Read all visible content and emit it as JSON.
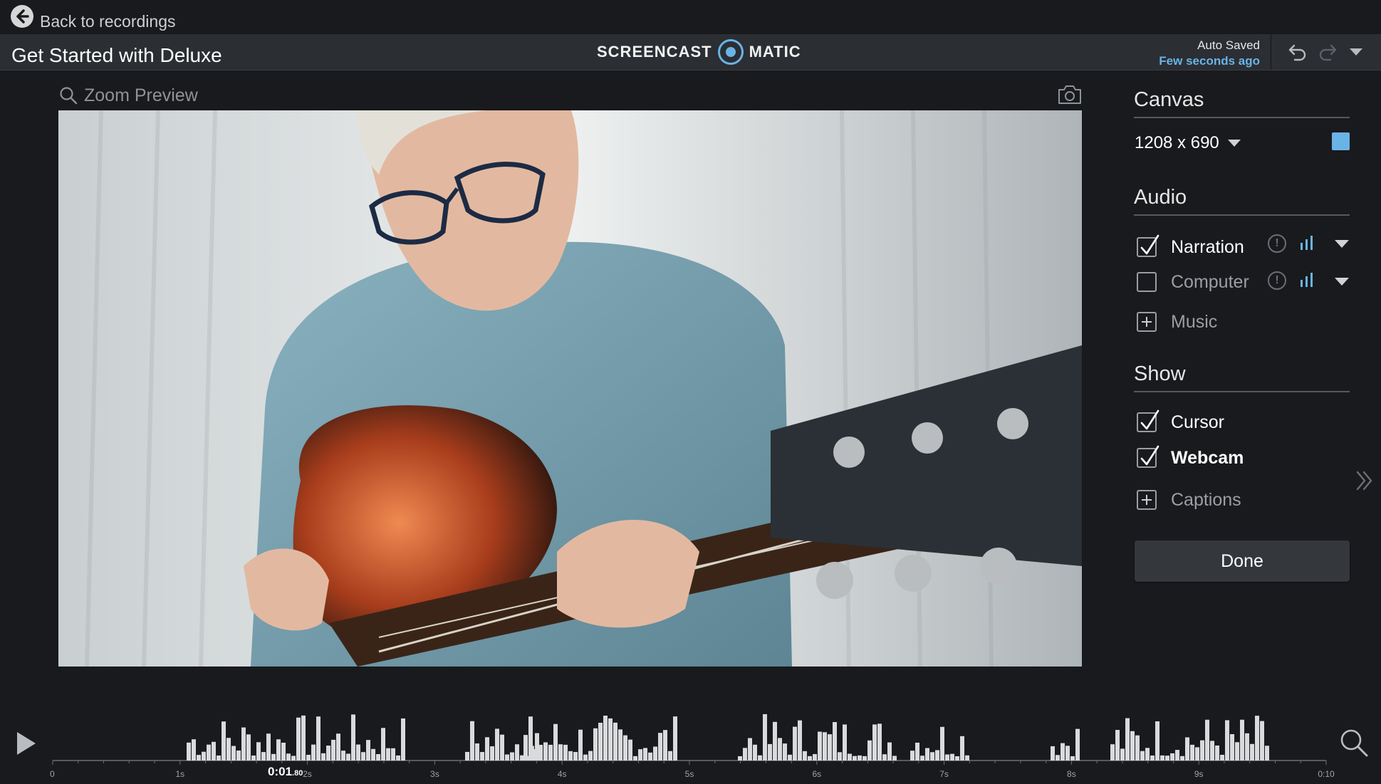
{
  "topbar": {
    "back_label": "Back to recordings"
  },
  "titlebar": {
    "title": "Get Started with Deluxe",
    "logo_left": "SCREENCAST",
    "logo_right": "MATIC",
    "autosave_label": "Auto Saved",
    "autosave_time": "Few seconds ago"
  },
  "preview": {
    "zoom_label": "Zoom Preview"
  },
  "sidebar": {
    "canvas": {
      "title": "Canvas",
      "size": "1208 x 690",
      "swatch_color": "#6ab3e6"
    },
    "audio": {
      "title": "Audio",
      "items": [
        {
          "label": "Narration",
          "checked": true
        },
        {
          "label": "Computer",
          "checked": false
        },
        {
          "label": "Music",
          "type": "add"
        }
      ]
    },
    "show": {
      "title": "Show",
      "items": [
        {
          "label": "Cursor",
          "checked": true
        },
        {
          "label": "Webcam",
          "checked": true
        },
        {
          "label": "Captions",
          "type": "add"
        }
      ]
    },
    "done_label": "Done"
  },
  "timeline": {
    "playhead_main": "0:01",
    "playhead_frac": ".80",
    "tick_labels": [
      "0",
      "1s",
      "2s",
      "3s",
      "4s",
      "5s",
      "6s",
      "7s",
      "8s",
      "9s",
      "0:10"
    ],
    "playhead_seconds": 1.8,
    "duration_seconds": 10
  },
  "colors": {
    "accent": "#6ab3e6",
    "background": "#191a1d",
    "titlebar": "#2b2e33"
  },
  "icons": [
    "back-arrow-icon",
    "undo-icon",
    "redo-icon",
    "menu-caret-icon",
    "search-icon",
    "camera-icon",
    "warning-icon",
    "audio-level-icon",
    "chevron-double-right-icon",
    "play-icon"
  ]
}
